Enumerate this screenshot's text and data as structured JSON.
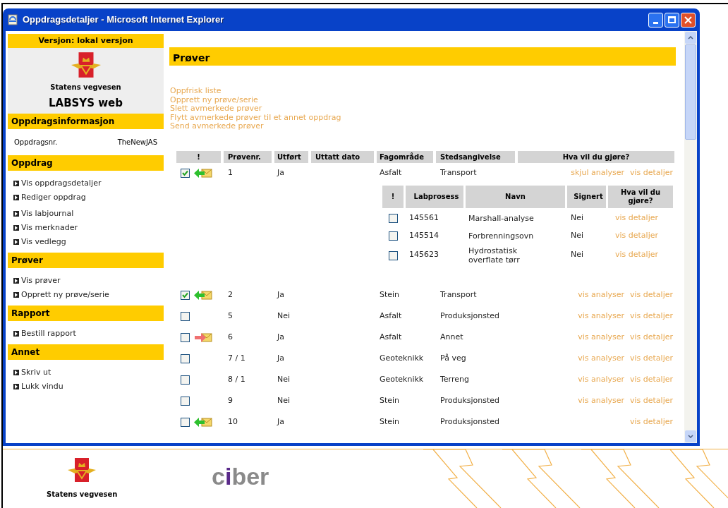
{
  "window": {
    "title": "Oppdragsdetaljer - Microsoft Internet Explorer"
  },
  "sidebar": {
    "version": "Versjon: lokal versjon",
    "org_name": "Statens vegvesen",
    "app_name": "LABSYS web",
    "sections": [
      {
        "kind": "info",
        "title": "Oppdragsinformasjon",
        "label": "Oppdragsnr.",
        "value": "TheNewJAS"
      },
      {
        "kind": "links",
        "title": "Oppdrag",
        "groups": [
          [
            "Vis oppdragsdetaljer",
            "Rediger oppdrag"
          ],
          [
            "Vis labjournal",
            "Vis merknader",
            "Vis vedlegg"
          ]
        ]
      },
      {
        "kind": "links",
        "title": "Prøver",
        "groups": [
          [
            "Vis prøver",
            "Opprett ny prøve/serie"
          ]
        ]
      },
      {
        "kind": "links",
        "title": "Rapport",
        "groups": [
          [
            "Bestill rapport"
          ]
        ]
      },
      {
        "kind": "links",
        "title": "Annet",
        "groups": [
          [
            "Skriv ut",
            "Lukk vindu"
          ]
        ]
      }
    ]
  },
  "main": {
    "heading": "Prøver",
    "actions": [
      "Oppfrisk liste",
      "Opprett ny prøve/serie",
      "Slett avmerkede prøver",
      "Flytt avmerkede prøver til et annet oppdrag",
      "Send avmerkede prøver"
    ],
    "table": {
      "columns": [
        "!",
        "Prøvenr.",
        "Utført",
        "Uttatt dato",
        "Fagområde",
        "Stedsangivelse",
        "Hva vil du gjøre?"
      ],
      "rows": [
        {
          "kind": "incoming",
          "checked": true,
          "number": "1",
          "done": "Ja",
          "field": "Asfalt",
          "location": "Transport",
          "actions": [
            "skjul analyser",
            "vis detaljer"
          ],
          "analyses": {
            "columns": [
              "!",
              "Labprosess",
              "Navn",
              "Signert",
              "Hva vil du gjøre?"
            ],
            "rows": [
              {
                "checked": false,
                "id": "145561",
                "name": "Marshall-analyse",
                "signed": "Nei",
                "action": "vis detaljer"
              },
              {
                "checked": false,
                "id": "145514",
                "name": "Forbrenningsovn",
                "signed": "Nei",
                "action": "vis detaljer"
              },
              {
                "checked": false,
                "id": "145623",
                "name": "Hydrostatisk overflate tørr",
                "signed": "Nei",
                "action": "vis detaljer"
              }
            ]
          }
        },
        {
          "kind": "incoming",
          "checked": true,
          "number": "2",
          "done": "Ja",
          "field": "Stein",
          "location": "Transport",
          "actions": [
            "vis analyser",
            "vis detaljer"
          ]
        },
        {
          "kind": "plain",
          "checked": false,
          "number": "5",
          "done": "Nei",
          "field": "Asfalt",
          "location": "Produksjonsted",
          "actions": [
            "vis analyser",
            "vis detaljer"
          ]
        },
        {
          "kind": "outgoing",
          "checked": false,
          "number": "6",
          "done": "Ja",
          "field": "Asfalt",
          "location": "Annet",
          "actions": [
            "vis analyser",
            "vis detaljer"
          ]
        },
        {
          "kind": "plain",
          "checked": false,
          "number": "7 / 1",
          "done": "Ja",
          "field": "Geoteknikk",
          "location": "På veg",
          "actions": [
            "vis analyser",
            "vis detaljer"
          ]
        },
        {
          "kind": "plain",
          "checked": false,
          "number": "8 / 1",
          "done": "Nei",
          "field": "Geoteknikk",
          "location": "Terreng",
          "actions": [
            "vis analyser",
            "vis detaljer"
          ]
        },
        {
          "kind": "plain",
          "checked": false,
          "number": "9",
          "done": "Nei",
          "field": "Stein",
          "location": "Produksjonsted",
          "actions": [
            "vis analyser",
            "vis detaljer"
          ]
        },
        {
          "kind": "incoming",
          "checked": false,
          "number": "10",
          "done": "Ja",
          "field": "Stein",
          "location": "Produksjonsted",
          "actions": [
            "vis detaljer"
          ]
        }
      ]
    }
  },
  "footer": {
    "org_name": "Statens vegvesen",
    "partner_logo": "ciber"
  }
}
